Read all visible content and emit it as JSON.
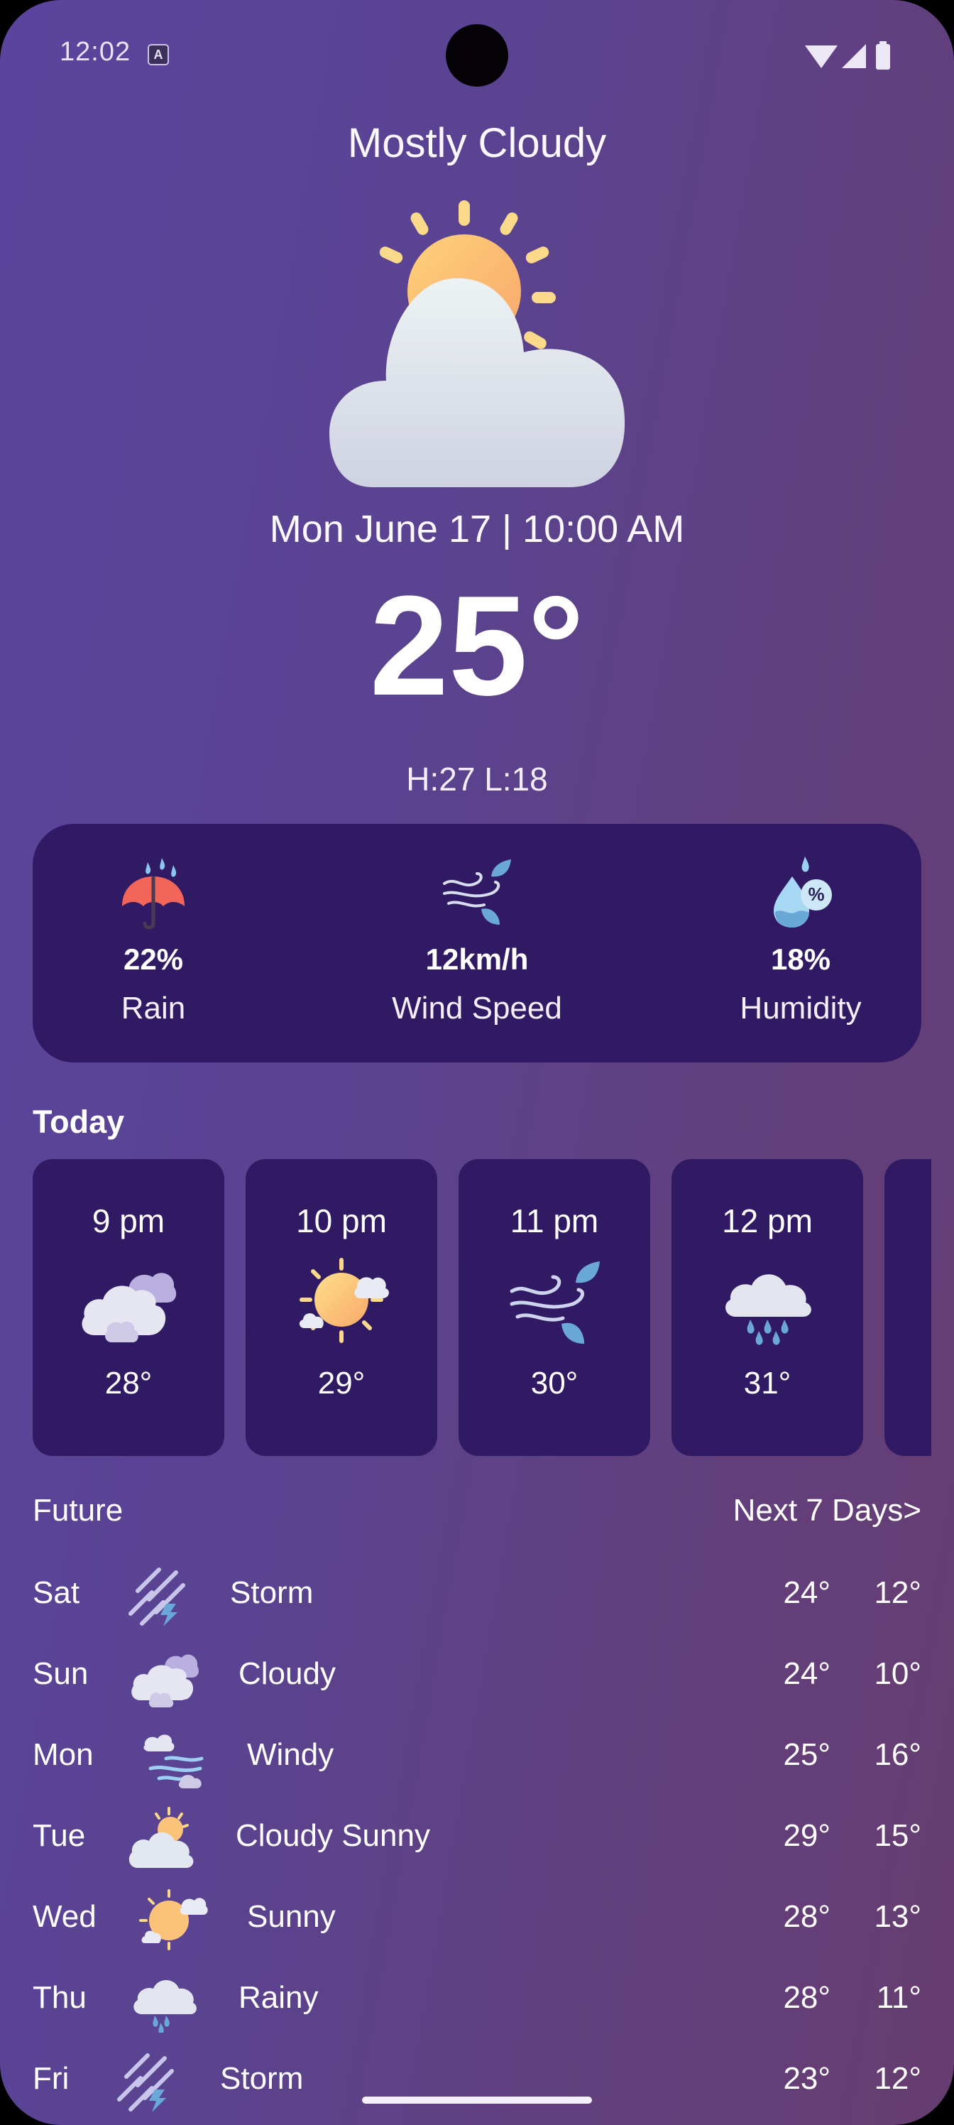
{
  "status": {
    "time": "12:02",
    "badge": "A"
  },
  "current": {
    "condition": "Mostly Cloudy",
    "datetime": "Mon June 17 | 10:00 AM",
    "temperature": "25°",
    "high_low": "H:27 L:18"
  },
  "stats": [
    {
      "value": "22%",
      "label": "Rain",
      "icon": "umbrella-icon"
    },
    {
      "value": "12km/h",
      "label": "Wind Speed",
      "icon": "wind-icon"
    },
    {
      "value": "18%",
      "label": "Humidity",
      "icon": "humidity-icon"
    }
  ],
  "today": {
    "title": "Today",
    "hours": [
      {
        "time": "9 pm",
        "temp": "28°",
        "icon": "cloudy-icon"
      },
      {
        "time": "10 pm",
        "temp": "29°",
        "icon": "sunny-icon"
      },
      {
        "time": "11 pm",
        "temp": "30°",
        "icon": "wind-icon"
      },
      {
        "time": "12 pm",
        "temp": "31°",
        "icon": "rain-icon"
      }
    ]
  },
  "future": {
    "title": "Future",
    "link": "Next 7 Days>",
    "days": [
      {
        "day": "Sat",
        "condition": "Storm",
        "high": "24°",
        "low": "12°",
        "icon": "storm-icon"
      },
      {
        "day": "Sun",
        "condition": "Cloudy",
        "high": "24°",
        "low": "10°",
        "icon": "cloudy-icon"
      },
      {
        "day": "Mon",
        "condition": "Windy",
        "high": "25°",
        "low": "16°",
        "icon": "windy-icon"
      },
      {
        "day": "Tue",
        "condition": "Cloudy Sunny",
        "high": "29°",
        "low": "15°",
        "icon": "cloudy-sunny-icon"
      },
      {
        "day": "Wed",
        "condition": "Sunny",
        "high": "28°",
        "low": "13°",
        "icon": "sunny-icon"
      },
      {
        "day": "Thu",
        "condition": "Rainy",
        "high": "28°",
        "low": "11°",
        "icon": "rain-icon"
      },
      {
        "day": "Fri",
        "condition": "Storm",
        "high": "23°",
        "low": "12°",
        "icon": "storm-icon"
      }
    ]
  },
  "colors": {
    "card_bg": "#311a64",
    "sun": "#fbc86e",
    "cloud": "#dfe6ec",
    "umbrella": "#f2665a",
    "leaf": "#6aa8d8"
  }
}
